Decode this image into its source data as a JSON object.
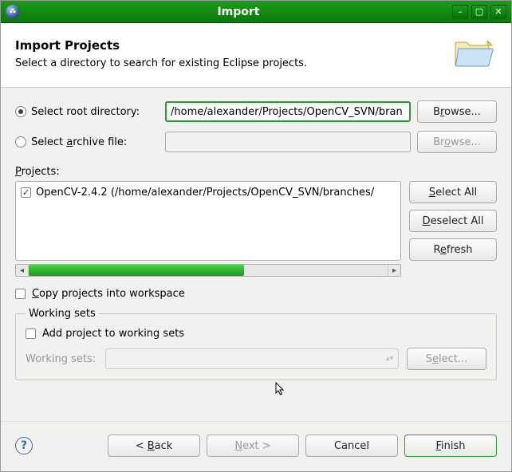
{
  "window": {
    "title": "Import"
  },
  "header": {
    "title": "Import Projects",
    "subtitle": "Select a directory to search for existing Eclipse projects."
  },
  "source": {
    "root_label": "Select root directory:",
    "archive_label": "Select archive file:",
    "root_value": "/home/alexander/Projects/OpenCV_SVN/bran",
    "archive_value": "",
    "browse_label": "Browse...",
    "browse_label_disabled": "Browse..."
  },
  "projects_label": "Projects:",
  "projects": [
    {
      "checked": true,
      "label": "OpenCV-2.4.2 (/home/alexander/Projects/OpenCV_SVN/branches/"
    }
  ],
  "side": {
    "select_all": "Select All",
    "deselect_all": "Deselect All",
    "refresh": "Refresh"
  },
  "copy_label": "Copy projects into workspace",
  "working_sets": {
    "legend": "Working sets",
    "add_label": "Add project to working sets",
    "field_label": "Working sets:",
    "select_label": "Select..."
  },
  "footer": {
    "back": "< Back",
    "next": "Next >",
    "cancel": "Cancel",
    "finish": "Finish"
  }
}
